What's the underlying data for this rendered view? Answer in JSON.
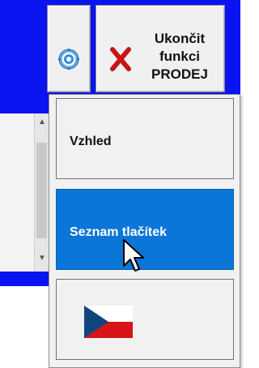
{
  "toolbar": {
    "settings_button": {
      "icon": "gear-icon"
    },
    "end_button": {
      "icon": "close-x-icon",
      "label_lines": [
        "Ukončit",
        "funkci",
        "PRODEJ"
      ],
      "icon_color": "#c81414"
    }
  },
  "dropdown": {
    "items": [
      {
        "label": "Vzhled",
        "selected": false
      },
      {
        "label": "Seznam tlačítek",
        "selected": true
      },
      {
        "label": "",
        "icon": "czech-flag-icon",
        "selected": false
      }
    ]
  },
  "colors": {
    "accent_blue": "#0a14f0",
    "selected_item": "#0a76d8"
  }
}
